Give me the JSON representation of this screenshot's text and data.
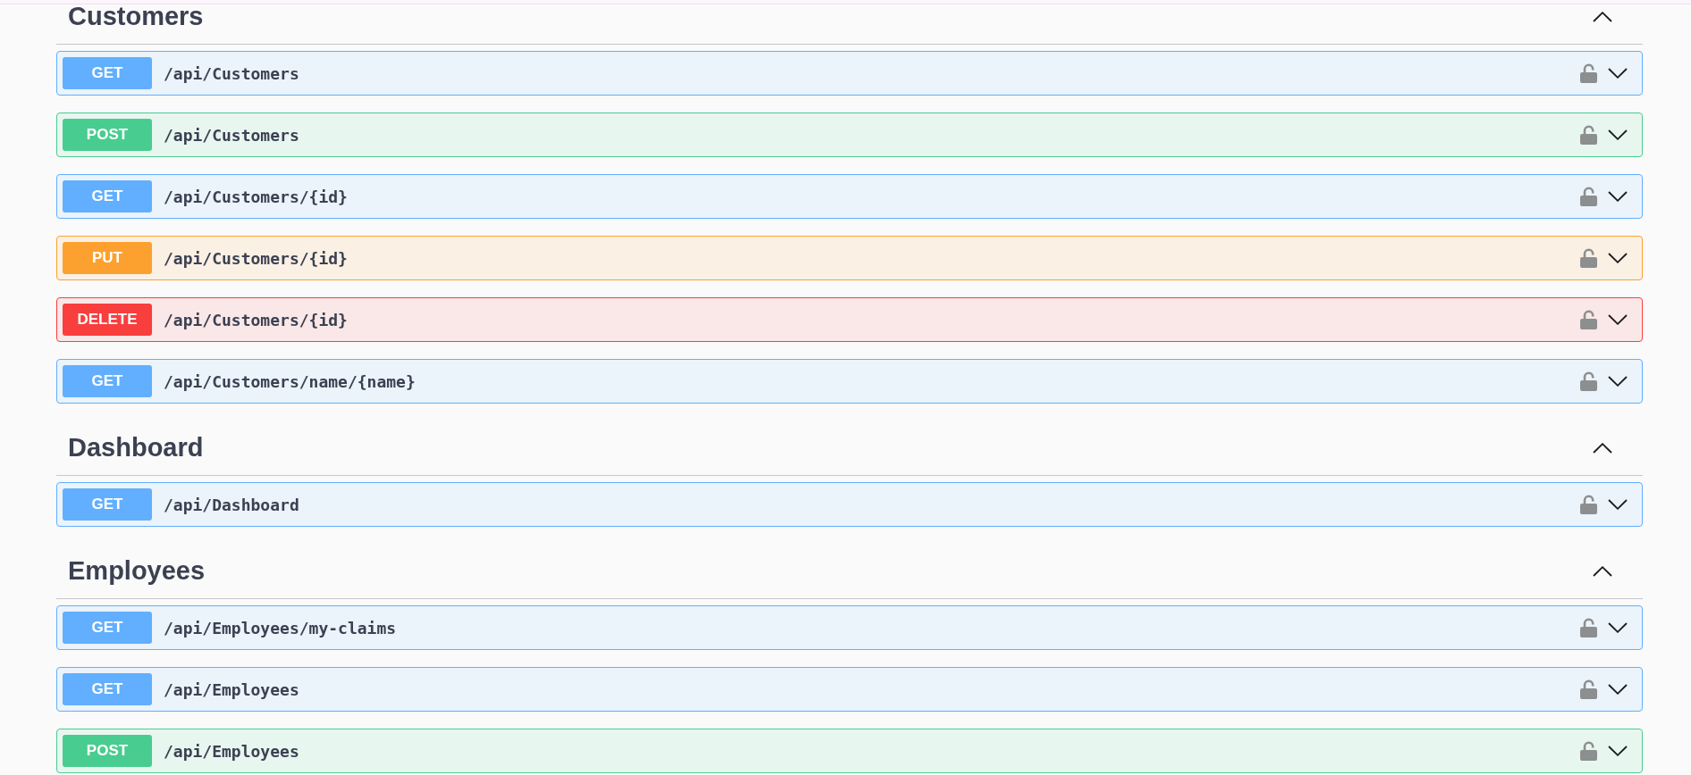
{
  "sections": [
    {
      "title": "Customers",
      "expanded": true,
      "endpoints": [
        {
          "kind": "get",
          "method": "GET",
          "path": "/api/Customers"
        },
        {
          "kind": "post",
          "method": "POST",
          "path": "/api/Customers"
        },
        {
          "kind": "get",
          "method": "GET",
          "path": "/api/Customers/{id}"
        },
        {
          "kind": "put",
          "method": "PUT",
          "path": "/api/Customers/{id}"
        },
        {
          "kind": "delete",
          "method": "DELETE",
          "path": "/api/Customers/{id}"
        },
        {
          "kind": "get",
          "method": "GET",
          "path": "/api/Customers/name/{name}"
        }
      ]
    },
    {
      "title": "Dashboard",
      "expanded": true,
      "endpoints": [
        {
          "kind": "get",
          "method": "GET",
          "path": "/api/Dashboard"
        }
      ]
    },
    {
      "title": "Employees",
      "expanded": true,
      "endpoints": [
        {
          "kind": "get",
          "method": "GET",
          "path": "/api/Employees/my-claims"
        },
        {
          "kind": "get",
          "method": "GET",
          "path": "/api/Employees"
        },
        {
          "kind": "post",
          "method": "POST",
          "path": "/api/Employees"
        }
      ]
    }
  ]
}
